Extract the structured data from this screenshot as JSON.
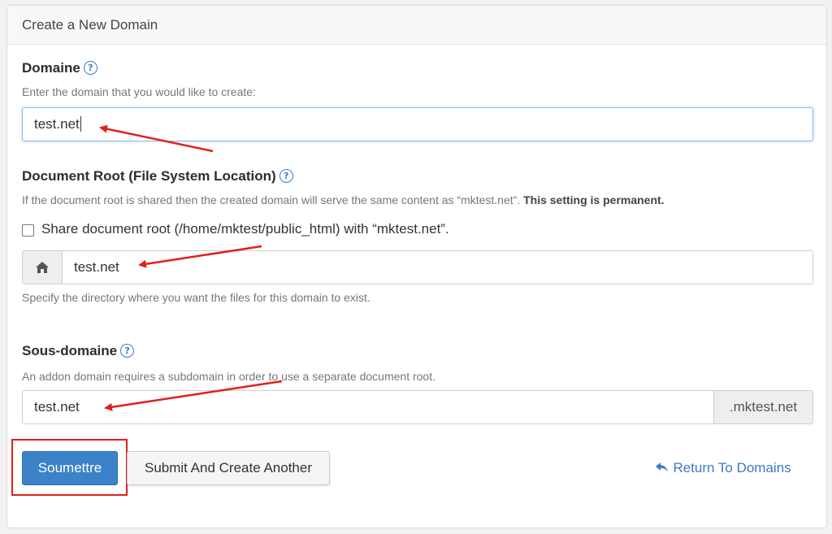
{
  "panel": {
    "title": "Create a New Domain"
  },
  "domain": {
    "label": "Domaine",
    "help": "Enter the domain that you would like to create:",
    "value": "test.net"
  },
  "docroot": {
    "label": "Document Root (File System Location)",
    "help_text": "If the document root is shared then the created domain will serve the same content as “mktest.net”.",
    "help_bold": "This setting is permanent.",
    "share_label": "Share document root (/home/mktest/public_html) with “mktest.net”.",
    "value": "test.net",
    "hint": "Specify the directory where you want the files for this domain to exist."
  },
  "subdomain": {
    "label": "Sous-domaine",
    "help": "An addon domain requires a subdomain in order to use a separate document root.",
    "value": "test.net",
    "suffix": ".mktest.net"
  },
  "actions": {
    "submit": "Soumettre",
    "submit_another": "Submit And Create Another",
    "return": "Return To Domains"
  },
  "icons": {
    "info": "info-icon",
    "home": "home-icon",
    "return": "return-arrow-icon"
  },
  "colors": {
    "primary": "#3b82c9",
    "link": "#3a7bc6",
    "annotation": "#e0201c"
  }
}
